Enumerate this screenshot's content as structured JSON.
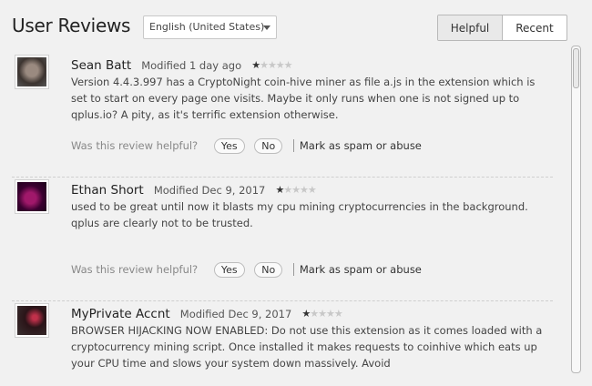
{
  "header": {
    "title": "User Reviews",
    "language": "English (United States)",
    "tabs": [
      {
        "label": "Helpful"
      },
      {
        "label": "Recent"
      }
    ]
  },
  "reviews": [
    {
      "name": "Sean Batt",
      "modified": "Modified 1 day ago",
      "rating": 1,
      "max_rating": 5,
      "text": "Version 4.4.3.997 has a CryptoNight coin-hive miner as file a.js in the extension which is set to start on every page one visits. Maybe it only runs when one is not signed up to qplus.io? A pity, as it's terrific extension otherwise.",
      "helpful_prompt": "Was this review helpful?",
      "yes_label": "Yes",
      "no_label": "No",
      "spam_label": "Mark as spam or abuse"
    },
    {
      "name": "Ethan Short",
      "modified": "Modified Dec 9, 2017",
      "rating": 1,
      "max_rating": 5,
      "text": "used to be great until now it blasts my cpu mining cryptocurrencies in the background. qplus are clearly not to be trusted.",
      "helpful_prompt": "Was this review helpful?",
      "yes_label": "Yes",
      "no_label": "No",
      "spam_label": "Mark as spam or abuse"
    },
    {
      "name": "MyPrivate Accnt",
      "modified": "Modified Dec 9, 2017",
      "rating": 1,
      "max_rating": 5,
      "text": "BROWSER HIJACKING NOW ENABLED: Do not use this extension as it comes loaded with a cryptocurrency mining script. Once installed it makes requests to coinhive which eats up your CPU time and slows your system down massively. Avoid"
    }
  ]
}
